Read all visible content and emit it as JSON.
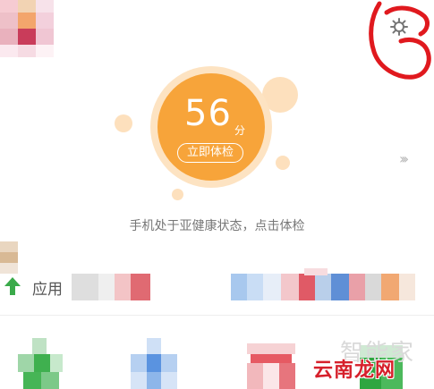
{
  "score": {
    "value": "56",
    "unit": "分",
    "button_label": "立即体检"
  },
  "status_text": "手机处于亚健康状态，点击体检",
  "section_label": "应用",
  "watermark": {
    "brand": "智能家",
    "site": "云南龙网"
  },
  "colors": {
    "accent_orange": "#f7a43a",
    "halo": "#fde3c2",
    "annotation_red": "#e0191e"
  },
  "icons": {
    "settings": "gear-icon",
    "more": "chevron-double-right-icon",
    "upload": "up-arrow-icon"
  }
}
